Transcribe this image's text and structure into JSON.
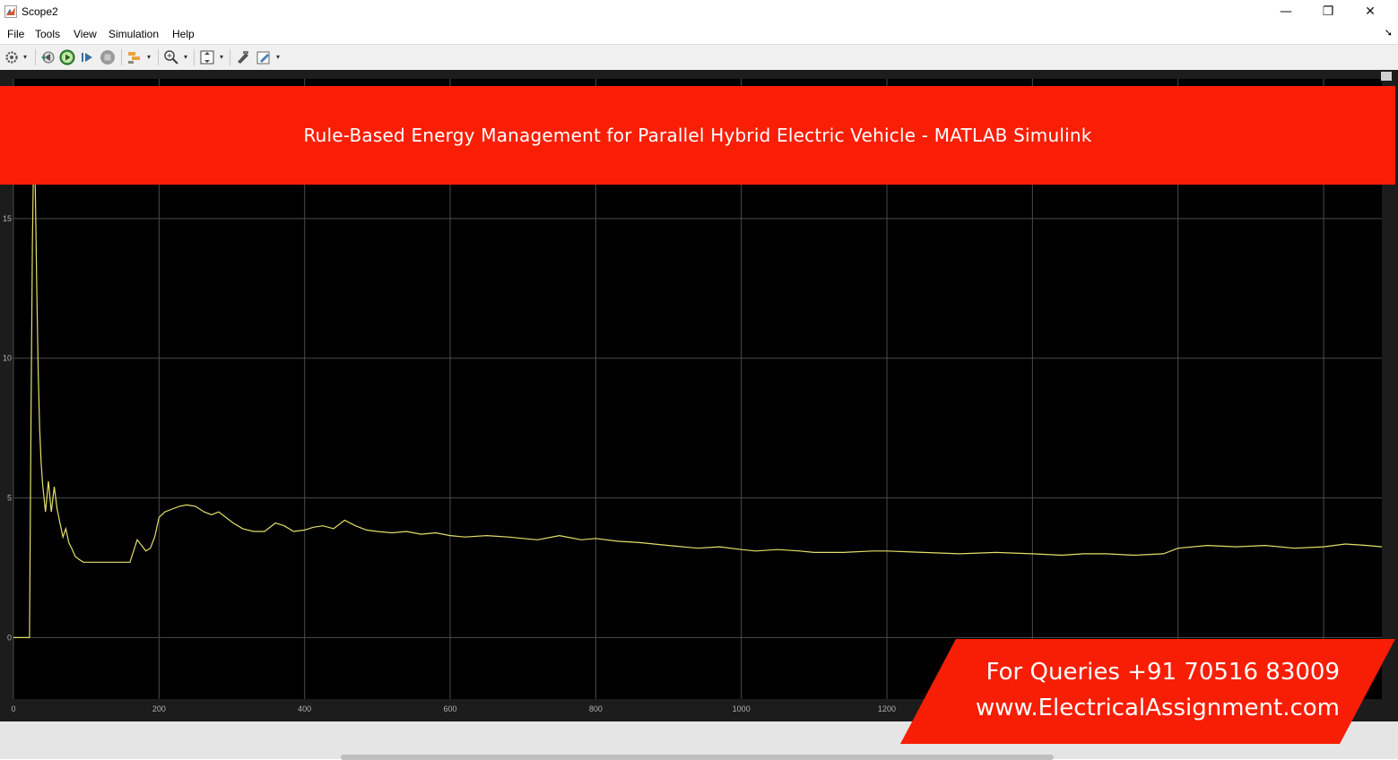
{
  "window": {
    "title": "Scope2",
    "controls": {
      "minimize": "—",
      "restore": "❐",
      "close": "✕"
    }
  },
  "menu": {
    "items": [
      "File",
      "Tools",
      "View",
      "Simulation",
      "Help"
    ],
    "overflow_icon": "arrow-icon"
  },
  "toolbar": {
    "buttons": [
      "settings-icon",
      "step-back-icon",
      "run-icon",
      "step-forward-icon",
      "stop-icon",
      "highlight-icon",
      "zoom-icon",
      "autoscale-icon",
      "write-icon",
      "edit-icon"
    ]
  },
  "banner": {
    "text": "Rule-Based Energy Management for Parallel Hybrid Electric Vehicle - MATLAB Simulink"
  },
  "badge": {
    "line1": "For Queries +91 70516 83009",
    "line2": "www.ElectricalAssignment.com"
  },
  "colors": {
    "banner": "#fa1e05",
    "plot_bg": "#000000",
    "trace": "#e3df6b",
    "grid": "#4a4a4a"
  },
  "chart_data": {
    "type": "line",
    "xlim": [
      0,
      1880
    ],
    "ylim": [
      -2.2,
      20
    ],
    "xticks": [
      0,
      200,
      400,
      600,
      800,
      1000,
      1200
    ],
    "yticks": [
      0,
      5,
      10,
      15
    ],
    "grid": true,
    "series": [
      {
        "x": [
          0,
          22,
          24,
          26,
          28,
          30,
          32,
          34,
          36,
          38,
          40,
          44,
          48,
          52,
          56,
          60,
          64,
          68,
          72,
          76,
          80,
          85,
          90,
          96,
          102,
          110,
          120,
          140,
          160,
          170,
          176,
          182,
          188,
          194,
          200,
          208,
          218,
          228,
          238,
          250,
          262,
          272,
          282,
          292,
          302,
          315,
          330,
          345,
          360,
          372,
          385,
          400,
          412,
          425,
          440,
          455,
          470,
          485,
          500,
          520,
          540,
          560,
          580,
          600,
          620,
          650,
          680,
          700,
          720,
          750,
          780,
          800,
          830,
          860,
          900,
          940,
          970,
          1000,
          1020,
          1050,
          1080,
          1100,
          1140,
          1180,
          1200,
          1250,
          1300,
          1350,
          1400,
          1440,
          1470,
          1500,
          1540,
          1580,
          1600,
          1640,
          1680,
          1720,
          1760,
          1800,
          1830,
          1860,
          1880
        ],
        "y": [
          0,
          0,
          7.5,
          14.0,
          17.8,
          16.0,
          12.5,
          9.5,
          7.5,
          6.3,
          5.5,
          4.5,
          5.6,
          4.5,
          5.4,
          4.6,
          4.1,
          3.6,
          3.9,
          3.4,
          3.2,
          2.9,
          2.8,
          2.7,
          2.7,
          2.7,
          2.7,
          2.7,
          2.7,
          3.5,
          3.3,
          3.1,
          3.2,
          3.6,
          4.3,
          4.5,
          4.6,
          4.7,
          4.75,
          4.7,
          4.5,
          4.4,
          4.5,
          4.3,
          4.1,
          3.9,
          3.8,
          3.8,
          4.1,
          4.0,
          3.8,
          3.85,
          3.95,
          4.0,
          3.9,
          4.2,
          4.0,
          3.85,
          3.8,
          3.75,
          3.8,
          3.7,
          3.75,
          3.65,
          3.6,
          3.65,
          3.6,
          3.55,
          3.5,
          3.65,
          3.5,
          3.55,
          3.45,
          3.4,
          3.3,
          3.2,
          3.25,
          3.15,
          3.1,
          3.15,
          3.1,
          3.05,
          3.05,
          3.1,
          3.1,
          3.05,
          3.0,
          3.05,
          3.0,
          2.95,
          3.0,
          3.0,
          2.95,
          3.0,
          3.2,
          3.3,
          3.25,
          3.3,
          3.2,
          3.25,
          3.35,
          3.3,
          3.25
        ]
      }
    ]
  }
}
